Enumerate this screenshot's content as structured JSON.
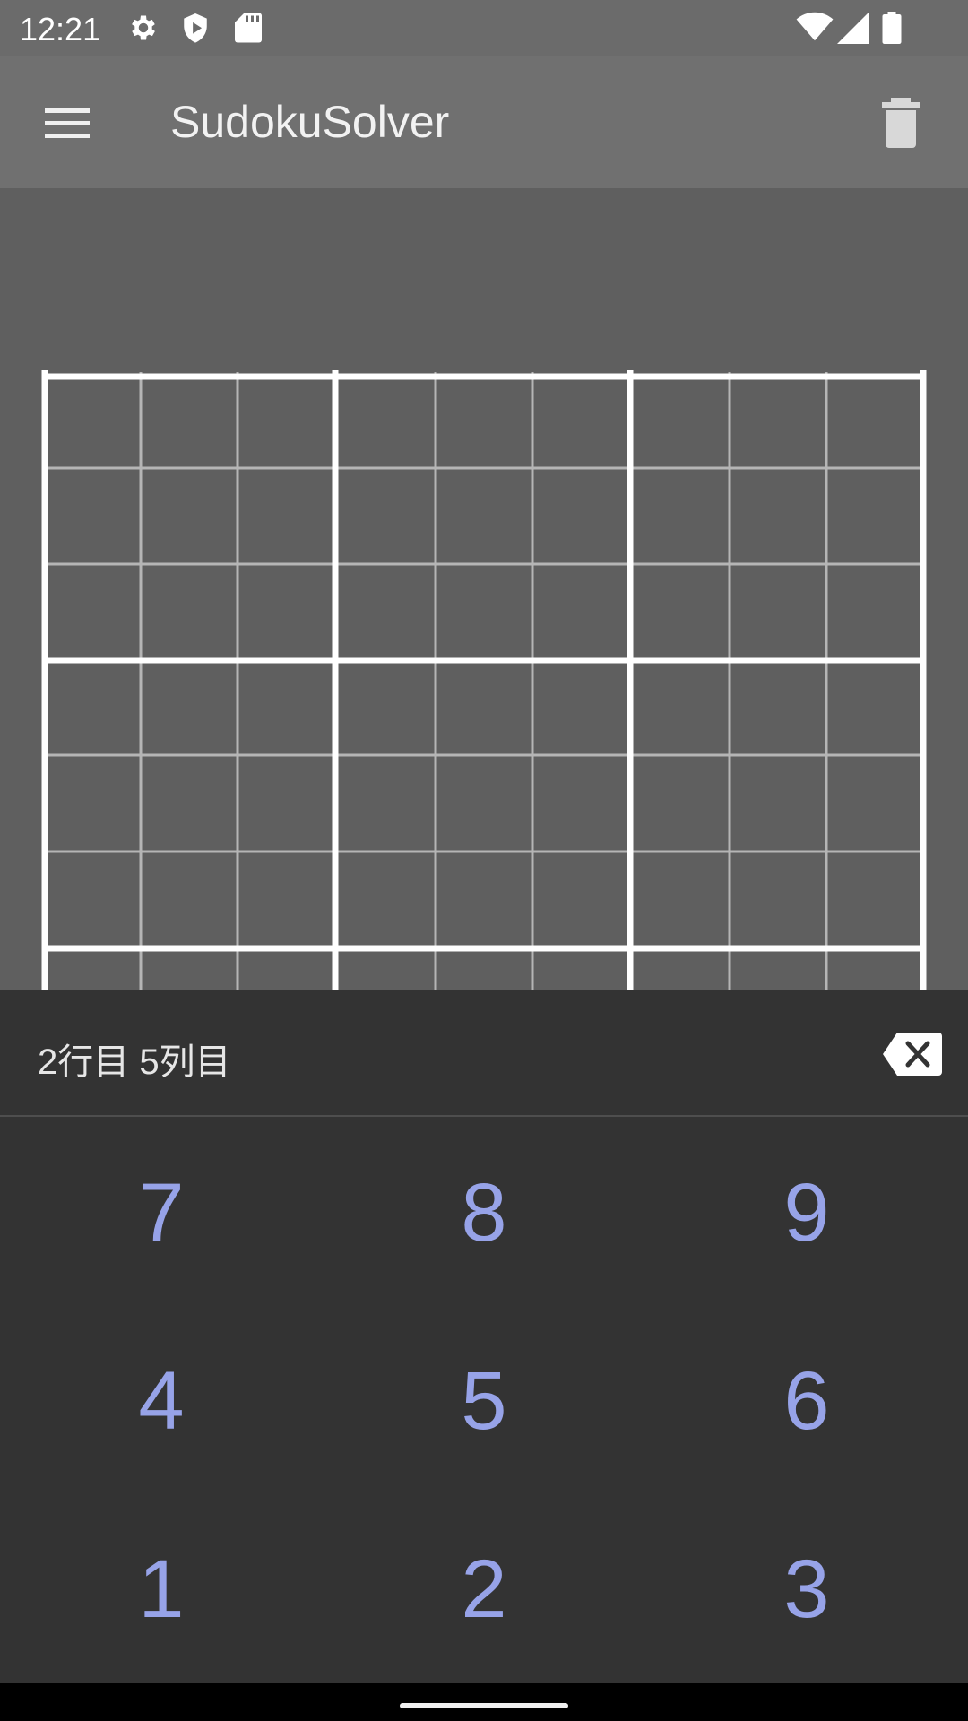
{
  "status_bar": {
    "time": "12:21",
    "left_icons": [
      "settings-icon",
      "shield-icon",
      "sd-card-icon"
    ],
    "right_icons": [
      "wifi-icon",
      "signal-icon",
      "battery-icon"
    ]
  },
  "app_bar": {
    "title": "SudokuSolver",
    "menu_icon": "hamburger-menu-icon",
    "action_icon": "trash-icon"
  },
  "board": {
    "size": 9,
    "cells": [
      [
        "",
        "",
        "",
        "",
        "",
        "",
        "",
        "",
        ""
      ],
      [
        "",
        "",
        "",
        "",
        "",
        "",
        "",
        "",
        ""
      ],
      [
        "",
        "",
        "",
        "",
        "",
        "",
        "",
        "",
        ""
      ],
      [
        "",
        "",
        "",
        "",
        "",
        "",
        "",
        "",
        ""
      ],
      [
        "",
        "",
        "",
        "",
        "",
        "",
        "",
        "",
        ""
      ],
      [
        "",
        "",
        "",
        "",
        "",
        "",
        "",
        "",
        ""
      ],
      [
        "",
        "",
        "",
        "",
        "",
        "",
        "",
        "",
        ""
      ],
      [
        "",
        "",
        "",
        "",
        "",
        "",
        "",
        "",
        ""
      ],
      [
        "",
        "",
        "",
        "",
        "",
        "",
        "",
        "",
        ""
      ]
    ]
  },
  "keypad": {
    "selected_cell_label": "2行目 5列目",
    "backspace_icon": "backspace-icon",
    "keys": [
      "7",
      "8",
      "9",
      "4",
      "5",
      "6",
      "1",
      "2",
      "3"
    ]
  },
  "colors": {
    "status_bar": "#6b6b6b",
    "app_bar": "#707070",
    "content_bg": "#5f5f5f",
    "keypad_bg": "#333333",
    "key_text": "#97a3e8"
  }
}
